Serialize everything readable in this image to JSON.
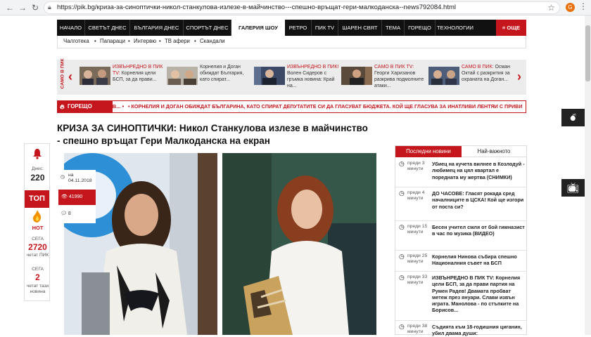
{
  "browser": {
    "url": "https://pik.bg/криза-за-синоптички-никол-станкулова-излезе-в-майчинство---спешно-връщат-гери-малкоданска--news792084.html"
  },
  "nav": {
    "items": [
      "НАЧАЛО",
      "СВЕТЪТ ДНЕС",
      "БЪЛГАРИЯ ДНЕС",
      "СПОРТЪТ ДНЕС",
      "ГАЛЕРИЯ ШОУ",
      "РЕТРО",
      "ПИК TV",
      "ШАРЕН СВЯТ",
      "ТЕМА",
      "ГОРЕЩО",
      "ТЕХНОЛОГИИ"
    ],
    "more": "ОЩЕ"
  },
  "subnav": [
    "Чалготека",
    "Папараци",
    "Интервю",
    "ТВ афери",
    "Скандали"
  ],
  "strip": {
    "label": "САМО В ПИК",
    "items": [
      {
        "prefix": "ИЗВЪНРЕДНО В ПИК TV:",
        "text": "Корнелия цели БСП, за да прави..."
      },
      {
        "prefix": "",
        "text": "Корнелия и Доган обиждат България, като спират..."
      },
      {
        "prefix": "ИЗВЪНРЕДНО В ПИК!",
        "text": "Волен Сидеров с гръмка новина: Край на..."
      },
      {
        "prefix": "САМО В ПИК TV:",
        "text": "Георги Харизанов разкрива подмолните атаки..."
      },
      {
        "prefix": "САМО В ПИК:",
        "text": "Осман Октай с разкрития за охраната на Доган..."
      }
    ]
  },
  "ticker": {
    "label": "ГОРЕЩО",
    "prev": "РИСОВ... •",
    "text": "• КОРНЕЛИЯ И ДОГАН ОБИЖДАТ БЪЛГАРИНА, КАТО СПИРАТ ДЕПУТАТИТЕ СИ ДА ГЛАСУВАТ БЮДЖЕТА. КОЙ ЩЕ ГЛАСУВА ЗА ИНАТЛИВИ ЛЕНТЯИ С ПРИВИ"
  },
  "headline": "КРИЗА ЗА СИНОПТИЧКИ: Никол Станкулова излезе в майчинство - спешно връщат Гери Малкоданска на екран",
  "leftbar": {
    "today_label": "Днес:",
    "today_value": "220",
    "top_label": "ТОП",
    "hot_label": "НОТ",
    "now_label": "СЕГА",
    "now_value": "2720",
    "now_caption": "четат ПИК",
    "now2_label": "СЕГА",
    "now2_value": "2",
    "now2_caption": "четат тази новина"
  },
  "meta": {
    "date_prefix": "на",
    "date": "04.11.2018",
    "views": "41990",
    "comments": "8"
  },
  "news": {
    "tab_latest": "Последни новини",
    "tab_top": "Най-важното",
    "items": [
      {
        "time": "преди 3 минути",
        "title": "Убиец на кучета вилнее в Козлодуй - любимец на цял квартал е поредната му жертва (СНИМКИ)"
      },
      {
        "time": "преди 4 минути",
        "title": "ДО ЧАСОВЕ: Гласят рокада сред началниците в ЦСКА! Кой ще изгори от поста си?"
      },
      {
        "time": "преди 15 минути",
        "title": "Бесен учител смля от бой гимназист в час по музика (ВИДЕО)"
      },
      {
        "time": "преди 25 минути",
        "title": "Корнелия Нинова събира спешно Националния съвет на БСП"
      },
      {
        "time": "преди 33 минути",
        "title": "ИЗВЪНРЕДНО В ПИК TV: Корнелия цели БСП, за да прави партия на Румен Радев! Двамата пробват метеж през януари. Слави извън играта. Манолова - по стъпките на Борисов..."
      },
      {
        "time": "преди 38 минути",
        "title": "Съдията към 18-годишния циганин, убил двама души:"
      }
    ]
  },
  "colors": {
    "brand_red": "#c4161c",
    "nav_black": "#111111"
  },
  "icons": [
    "bell-icon",
    "flame-icon",
    "clock-icon",
    "eye-icon",
    "comment-icon",
    "bomb-icon",
    "tv-icon",
    "star-icon",
    "lock-icon"
  ]
}
